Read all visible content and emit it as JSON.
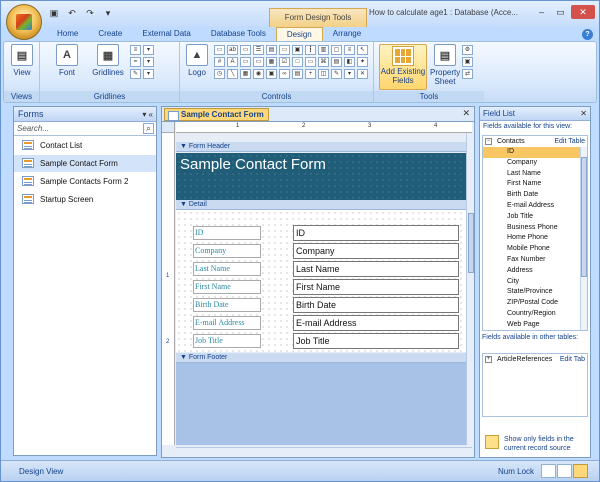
{
  "window": {
    "title": "How to calculate age1 : Database (Acce...",
    "context_tab": "Form Design Tools",
    "controls": [
      "–",
      "▭",
      "✕"
    ]
  },
  "quick_access": [
    "save-icon",
    "undo-icon",
    "redo-icon",
    "customize-icon"
  ],
  "tabs": [
    {
      "label": "Home"
    },
    {
      "label": "Create"
    },
    {
      "label": "External Data"
    },
    {
      "label": "Database Tools"
    },
    {
      "label": "Design",
      "active": true
    },
    {
      "label": "Arrange"
    }
  ],
  "ribbon": {
    "view_label": "View",
    "font_label": "Font",
    "gridlines_label": "Gridlines",
    "logo_label": "Logo",
    "add_fields_label": "Add Existing Fields",
    "property_label": "Property Sheet",
    "groups": {
      "views": "Views",
      "gridlines": "Gridlines",
      "controls": "Controls",
      "tools": "Tools"
    }
  },
  "nav": {
    "title": "Forms",
    "search_placeholder": "Search...",
    "items": [
      {
        "label": "Contact List",
        "selected": false
      },
      {
        "label": "Sample Contact Form",
        "selected": true
      },
      {
        "label": "Sample Contacts Form 2",
        "selected": false
      },
      {
        "label": "Startup Screen",
        "selected": false
      }
    ]
  },
  "document": {
    "tab_label": "Sample Contact Form",
    "ruler_numbers": [
      "1",
      "2",
      "3",
      "4",
      "5"
    ],
    "vruler_numbers": [
      "1",
      "2"
    ],
    "sections": {
      "header": "Form Header",
      "detail": "Detail",
      "footer": "Form Footer"
    },
    "header_title": "Sample Contact Form",
    "fields": [
      {
        "label": "ID",
        "value": "ID"
      },
      {
        "label": "Company",
        "value": "Company"
      },
      {
        "label": "Last Name",
        "value": "Last Name"
      },
      {
        "label": "First Name",
        "value": "First Name"
      },
      {
        "label": "Birth Date",
        "value": "Birth Date"
      },
      {
        "label": "E-mail Address",
        "value": "E-mail Address"
      },
      {
        "label": "Job Title",
        "value": "Job Title"
      }
    ]
  },
  "field_list": {
    "title": "Field List",
    "available_label": "Fields available for this view:",
    "table_name": "Contacts",
    "edit_table": "Edit Table",
    "fields": [
      "ID",
      "Company",
      "Last Name",
      "First Name",
      "Birth Date",
      "E-mail Address",
      "Job Title",
      "Business Phone",
      "Home Phone",
      "Mobile Phone",
      "Fax Number",
      "Address",
      "City",
      "State/Province",
      "ZIP/Postal Code",
      "Country/Region",
      "Web Page"
    ],
    "selected_field": "ID",
    "other_label": "Fields available in other tables:",
    "other_table": "ArticleReferences",
    "other_edit": "Edit Tab",
    "show_only_label": "Show only fields in the current record source"
  },
  "status": {
    "left": "Design View",
    "right": "Num Lock"
  }
}
